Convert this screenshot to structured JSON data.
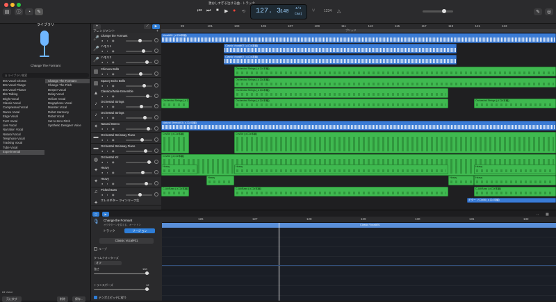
{
  "window": {
    "title": "激おしすぎる泣ける曲 - トラック"
  },
  "lcd": {
    "bar_beat": "127. 3",
    "tempo": "140",
    "signature": "4/4",
    "key": "Cmaj"
  },
  "transport": {
    "rewind": "⏮",
    "ff": "⏭",
    "stop": "■",
    "play": "▶",
    "record": "●"
  },
  "library": {
    "title": "ライブラリ",
    "preset": "Change The Formant",
    "search_placeholder": "Q ライブラリ検索",
    "categories": [
      "80s Vocal Chorus",
      "80s Vocal Flange",
      "80s Vocal Phaser",
      "8bs Talking",
      "Bright Vocal",
      "Classic Vocal",
      "Compressed Vocal",
      "Dance Vocal",
      "Edge Vocal",
      "Fuzz Vocal",
      "Live Vocal",
      "Narration Vocal",
      "Natural Vocal",
      "Telephone Vocal",
      "Tracking Vocal",
      "Tube Vocal",
      "Experimental"
    ],
    "presets": [
      "Change The Formant",
      "Change The Pitch",
      "Deeper Vocal",
      "Delay Vocal",
      "Helium Vocal",
      "Megaphone Vocal",
      "Monster Vocal",
      "Robot Harmony",
      "Robot Vocal",
      "Set to Zero Pitch",
      "Synthetic Designer Voice"
    ],
    "footer_left": "84 Voice",
    "btn_revert": "元に戻す",
    "btn_delete": "削除",
    "btn_save": "保存..."
  },
  "arrange": {
    "header": "アレンジメント",
    "ruler": [
      "99",
      "101",
      "103",
      "105",
      "107",
      "109",
      "111",
      "113",
      "115",
      "117",
      "119",
      "121",
      "123"
    ],
    "section_label": "ブリッジ"
  },
  "tracks": [
    {
      "name": "Change the Formant",
      "icon": "mic-icon"
    },
    {
      "name": "ハモリ1",
      "icon": "mic-icon"
    },
    {
      "name": "ハモリ2",
      "icon": "mic-icon"
    },
    {
      "name": "Chimera Bells",
      "icon": "keys-icon"
    },
    {
      "name": "Spacey Echo Bells",
      "icon": "keys-icon"
    },
    {
      "name": "Classical Male Ensemble",
      "icon": "voices-icon"
    },
    {
      "name": "Orchestral Strings",
      "icon": "violin-icon"
    },
    {
      "name": "Orchestral Strings",
      "icon": "violin-icon"
    },
    {
      "name": "Natural Stereo",
      "icon": "guitar-icon"
    },
    {
      "name": "Orchestral Steinway Piano",
      "icon": "piano-icon"
    },
    {
      "name": "Orchestral Steinway Piano",
      "icon": "piano-icon"
    },
    {
      "name": "Orchestral Kit",
      "icon": "drum-icon"
    },
    {
      "name": "Heavy",
      "icon": "guitar-icon"
    },
    {
      "name": "Heavy",
      "icon": "guitar-icon"
    },
    {
      "name": "Picked Bass",
      "icon": "bass-icon"
    },
    {
      "name": "エレキギター ツインリーフ生",
      "icon": "guitar-icon"
    }
  ],
  "regions": {
    "vocal1": "Vocal#01 (メロ#本編)",
    "vocal2": "Classic Vocal#07 (メロ#本編)",
    "harmony": "Classic Vocal#07 (メロ#本編)",
    "natural": "Natural Stereo#03 (メロ#本編)",
    "strings": "Orchestral Strings (メロ#本編)",
    "pianoA": "Cm/D# (メロ#本編)",
    "pianoB": "Cm/D# (メロ#本編)",
    "heavy": "Heavy",
    "bass": "C-A#/Bass (メロ#本編)",
    "tail": "ギター ソロ#06 (メロ#本編)"
  },
  "editor": {
    "region_title": "Change the Formant",
    "region_sub": "オクタターンを変える、オートドン",
    "tab_track": "トラック",
    "tab_region": "リージョン",
    "region_name": "Classic Vocal#01",
    "loop_label": "ループ",
    "timing_label": "タイムクオンタイズ",
    "timing_value": "オフ",
    "gain_label": "強さ",
    "gain_value": "100",
    "transpose_label": "トランスポーズ",
    "transpose_value": "12",
    "follow_label": "テンポとピッチに従う",
    "ruler": [
      "126",
      "127",
      "128",
      "129",
      "130",
      "131",
      "132"
    ],
    "region_label": "Classic Vocal#01"
  }
}
